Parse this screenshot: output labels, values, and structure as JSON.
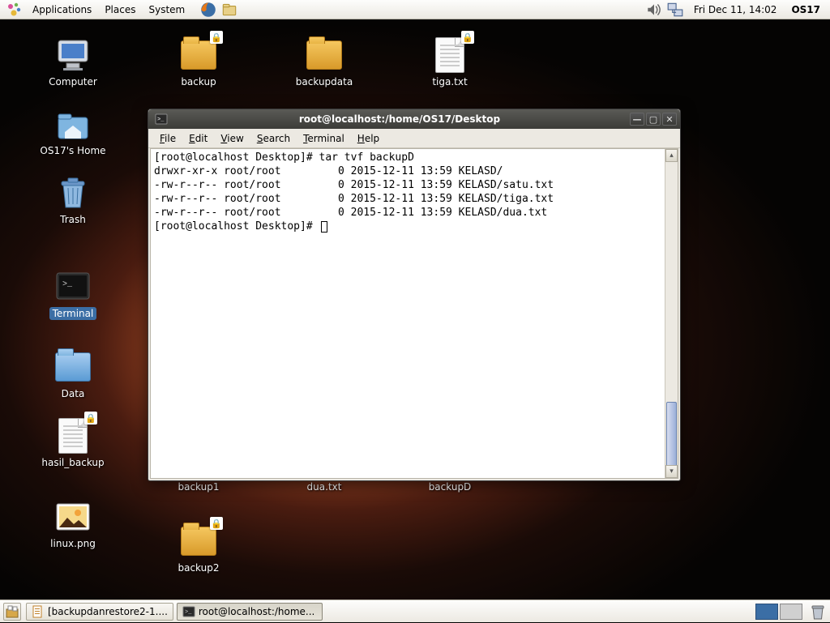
{
  "panel": {
    "menus": [
      "Applications",
      "Places",
      "System"
    ],
    "clock": "Fri Dec 11, 14:02",
    "user": "OS17"
  },
  "desktop_icons": {
    "computer": "Computer",
    "home": "OS17's Home",
    "trash": "Trash",
    "terminal": "Terminal",
    "data": "Data",
    "hasil": "hasil_backup",
    "linux": "linux.png",
    "backup": "backup",
    "backupdata": "backupdata",
    "tiga": "tiga.txt",
    "backup1": "backup1",
    "dua": "dua.txt",
    "backupD": "backupD",
    "backup2": "backup2"
  },
  "window": {
    "title": "root@localhost:/home/OS17/Desktop",
    "menus": {
      "file": "File",
      "edit": "Edit",
      "view": "View",
      "search": "Search",
      "terminal": "Terminal",
      "help": "Help"
    },
    "lines": [
      "[root@localhost Desktop]# tar tvf backupD",
      "drwxr-xr-x root/root         0 2015-12-11 13:59 KELASD/",
      "-rw-r--r-- root/root         0 2015-12-11 13:59 KELASD/satu.txt",
      "-rw-r--r-- root/root         0 2015-12-11 13:59 KELASD/tiga.txt",
      "-rw-r--r-- root/root         0 2015-12-11 13:59 KELASD/dua.txt",
      "[root@localhost Desktop]# "
    ]
  },
  "taskbar": {
    "task1": "[backupdanrestore2-1....",
    "task2": "root@localhost:/home..."
  }
}
